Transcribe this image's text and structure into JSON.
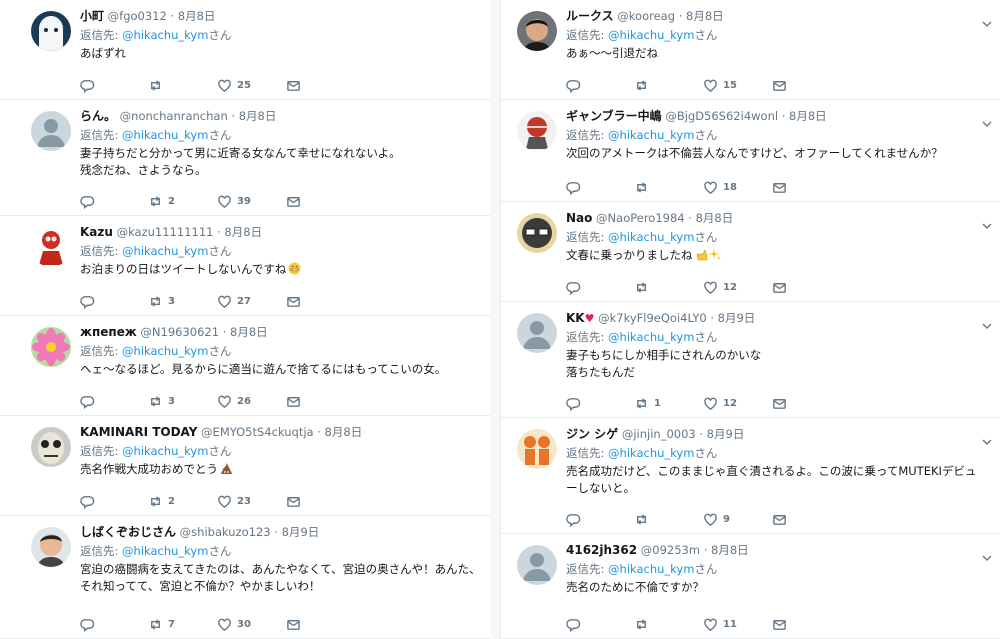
{
  "reply_prefix": "返信先:",
  "reply_suffix": "さん",
  "left": [
    {
      "name": "小町",
      "handle": "@fgo0312",
      "date": "· 8月8日",
      "reply_to": "@hikachu_kym",
      "text": "あばずれ",
      "reply_count": "",
      "retweet_count": "",
      "like_count": "25",
      "avatar": "ghost-avatar"
    },
    {
      "name": "らん。",
      "handle": "@nonchanranchan",
      "date": "· 8月8日",
      "reply_to": "@hikachu_kym",
      "text": "妻子持ちだと分かって男に近寄る女なんて幸せになれないよ。\n残念だね、さようなら。",
      "reply_count": "",
      "retweet_count": "2",
      "like_count": "39",
      "avatar": "default-avatar"
    },
    {
      "name": "Kazu",
      "handle": "@kazu11111111",
      "date": "· 8月8日",
      "reply_to": "@hikachu_kym",
      "text": "お泊まりの日はツイートしないんですね",
      "emoji": "grin-emoji",
      "reply_count": "",
      "retweet_count": "3",
      "like_count": "27",
      "avatar": "red-figure-avatar"
    },
    {
      "name": "жпепеж",
      "handle": "@N19630621",
      "date": "· 8月8日",
      "reply_to": "@hikachu_kym",
      "text": "ヘェ〜なるほど。見るからに適当に遊んで捨てるにはもってこいの女。",
      "reply_count": "",
      "retweet_count": "3",
      "like_count": "26",
      "avatar": "flower-avatar"
    },
    {
      "name": "KAMINARI TODAY",
      "handle": "@EMYO5tS4ckuqtja",
      "date": "· 8月8日",
      "reply_to": "@hikachu_kym",
      "text": "売名作戦大成功おめでとう",
      "emoji": "poop-emoji",
      "reply_count": "",
      "retweet_count": "2",
      "like_count": "23",
      "avatar": "mask-avatar"
    },
    {
      "name": "しばくぞおじさん",
      "handle": "@shibakuzo123",
      "date": "· 8月9日",
      "reply_to": "@hikachu_kym",
      "text": "宮迫の癌闘病を支えてきたのは、あんたやなくて、宮迫の奥さんや！あんた、\nそれ知ってて、宮迫と不倫か？やかましいわ！",
      "reply_count": "",
      "retweet_count": "7",
      "like_count": "30",
      "avatar": "man-avatar"
    }
  ],
  "right": [
    {
      "name": "ルークス",
      "handle": "@kooreag",
      "date": "· 8月8日",
      "reply_to": "@hikachu_kym",
      "text": "あぁ〜〜引退だね",
      "reply_count": "",
      "retweet_count": "",
      "like_count": "15",
      "avatar": "man-dark-avatar"
    },
    {
      "name": "ギャンブラー中嶋",
      "handle": "@BjgD56S62i4wonl",
      "date": "· 8月8日",
      "reply_to": "@hikachu_kym",
      "text": "次回のアメトークは不倫芸人なんですけど、オファーしてくれませんか？",
      "reply_count": "",
      "retweet_count": "",
      "like_count": "18",
      "avatar": "helmet-avatar"
    },
    {
      "name": "Nao",
      "handle": "@NaoPero1984",
      "date": "· 8月8日",
      "reply_to": "@hikachu_kym",
      "text": "文春に乗っかりましたね",
      "emoji": "point-sparkle-emoji",
      "reply_count": "",
      "retweet_count": "",
      "like_count": "12",
      "avatar": "glasses-avatar"
    },
    {
      "name": "KK",
      "name_suffix": "♥",
      "handle": "@k7kyFl9eQoi4LY0",
      "date": "· 8月9日",
      "reply_to": "@hikachu_kym",
      "text": "妻子もちにしか相手にされんのかいな\n落ちたもんだ",
      "reply_count": "",
      "retweet_count": "1",
      "like_count": "12",
      "avatar": "default-avatar"
    },
    {
      "name": "ジン シゲ",
      "handle": "@jinjin_0003",
      "date": "· 8月9日",
      "reply_to": "@hikachu_kym",
      "text": "売名成功だけど、このままじゃ直ぐ潰されるよ。この波に乗ってMUTEKIデビューしないと。",
      "reply_count": "",
      "retweet_count": "",
      "like_count": "9",
      "avatar": "orange-figures-avatar"
    },
    {
      "name": "4162jh362",
      "handle": "@09253m",
      "date": "· 8月8日",
      "reply_to": "@hikachu_kym",
      "text": "売名のために不倫ですか？",
      "reply_count": "",
      "retweet_count": "",
      "like_count": "11",
      "avatar": "default-avatar"
    }
  ]
}
